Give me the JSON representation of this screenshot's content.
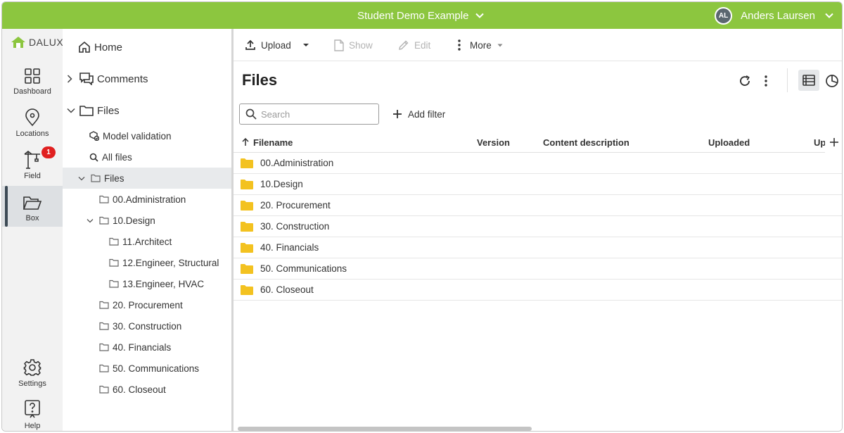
{
  "topbar": {
    "project_name": "Student Demo Example",
    "user_initials": "AL",
    "user_name": "Anders Laursen"
  },
  "brand": {
    "logo_text": "DALUX",
    "accent_color": "#8cc63f"
  },
  "rail": {
    "items": [
      {
        "label": "Dashboard",
        "icon": "dashboard-icon"
      },
      {
        "label": "Locations",
        "icon": "location-pin-icon"
      },
      {
        "label": "Field",
        "icon": "crane-icon",
        "badge": "1"
      },
      {
        "label": "Box",
        "icon": "open-folder-icon",
        "active": true
      },
      {
        "label": "Settings",
        "icon": "gear-icon"
      },
      {
        "label": "Help",
        "icon": "help-icon"
      }
    ]
  },
  "tree": {
    "home": "Home",
    "comments": "Comments",
    "files_root": "Files",
    "model_validation": "Model validation",
    "all_files": "All files",
    "files_folder": "Files",
    "folders": {
      "admin": "00.Administration",
      "design": "10.Design",
      "architect": "11.Architect",
      "structural": "12.Engineer, Structural",
      "hvac": "13.Engineer, HVAC",
      "procurement": "20. Procurement",
      "construction": "30. Construction",
      "financials": "40. Financials",
      "communications": "50. Communications",
      "closeout": "60. Closeout"
    }
  },
  "toolbar": {
    "upload": "Upload",
    "show": "Show",
    "edit": "Edit",
    "more": "More"
  },
  "main": {
    "title": "Files",
    "search_placeholder": "Search",
    "add_filter": "Add filter",
    "columns": [
      "Filename",
      "Version",
      "Content description",
      "Uploaded",
      "Upl"
    ],
    "rows": [
      "00.Administration",
      "10.Design",
      "20. Procurement",
      "30. Construction",
      "40. Financials",
      "50. Communications",
      "60. Closeout"
    ]
  }
}
